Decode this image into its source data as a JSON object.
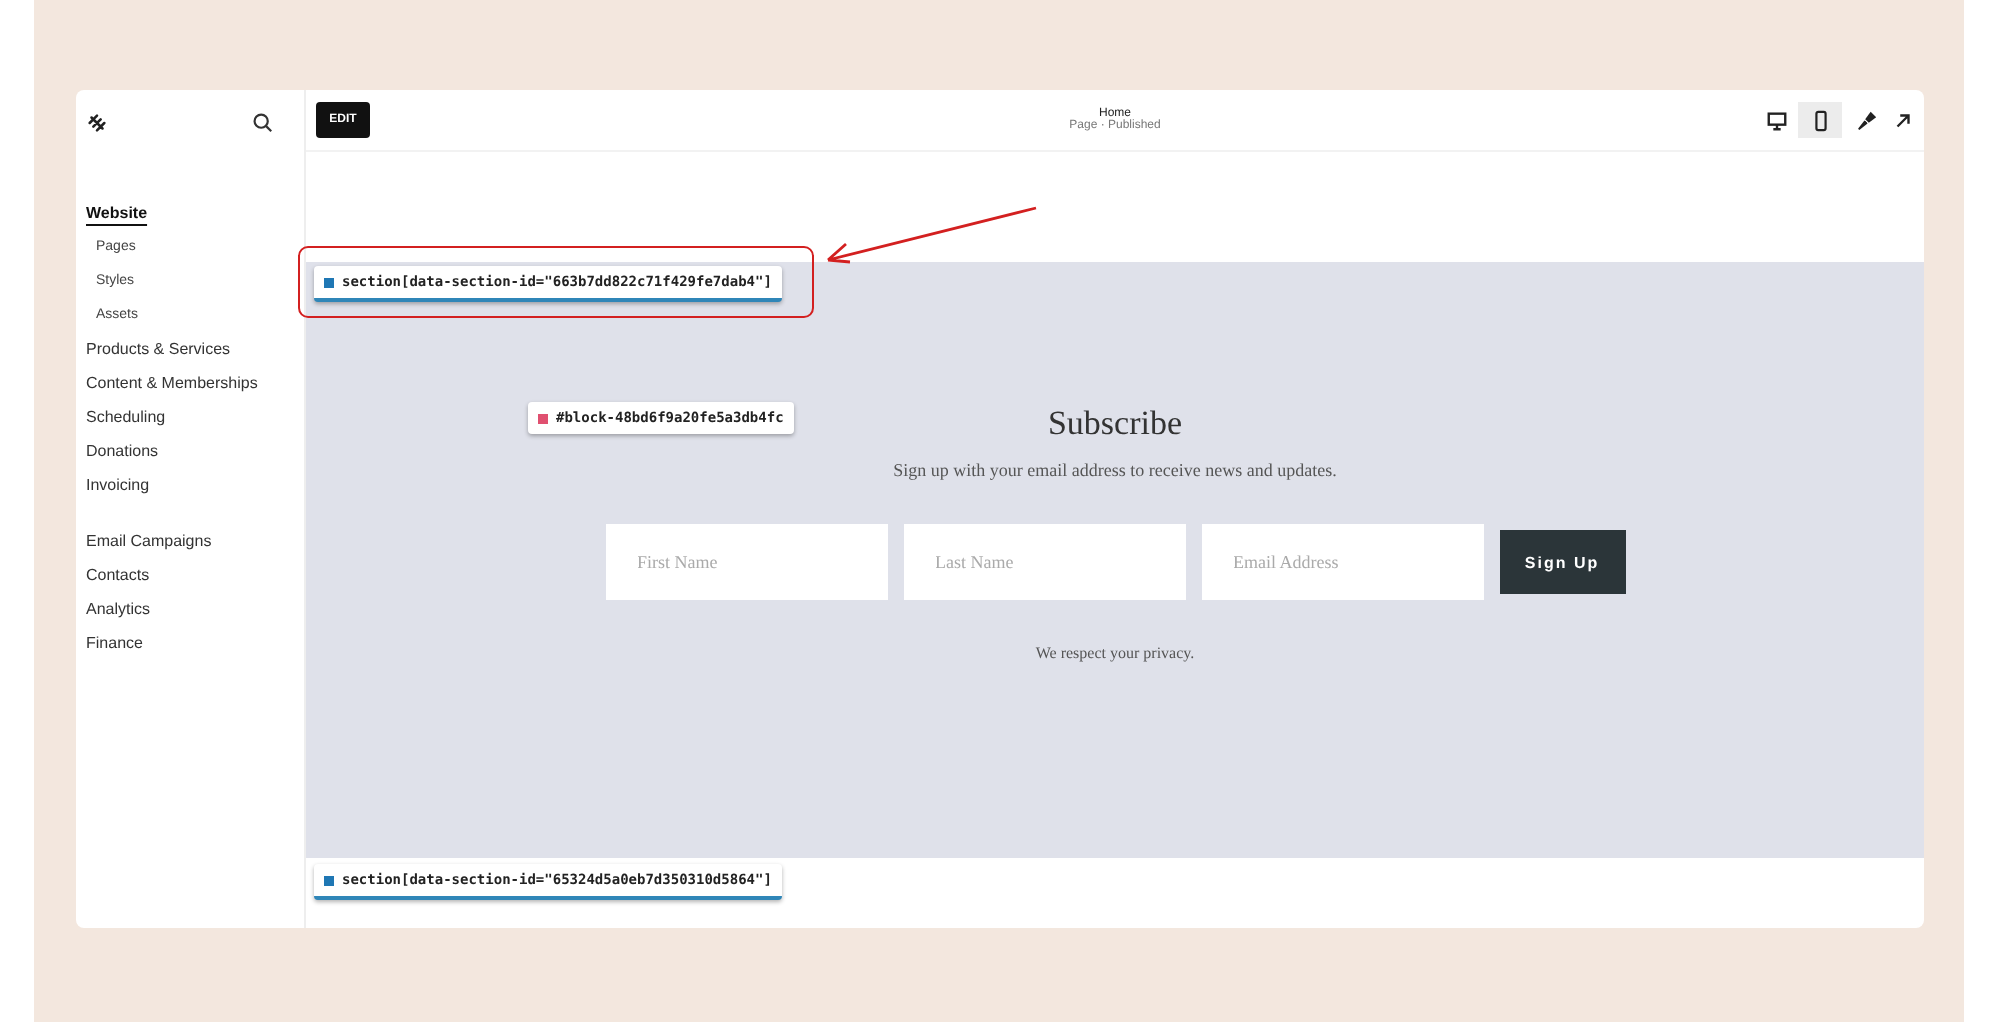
{
  "sidebar": {
    "items": [
      {
        "label": "Website",
        "selected": true,
        "children": [
          {
            "label": "Pages"
          },
          {
            "label": "Styles"
          },
          {
            "label": "Assets"
          }
        ]
      },
      {
        "label": "Products & Services",
        "selected": false
      },
      {
        "label": "Content & Memberships",
        "selected": false
      },
      {
        "label": "Scheduling",
        "selected": false
      },
      {
        "label": "Donations",
        "selected": false
      },
      {
        "label": "Invoicing",
        "selected": false
      }
    ],
    "items_2": [
      {
        "label": "Email Campaigns"
      },
      {
        "label": "Contacts"
      },
      {
        "label": "Analytics"
      },
      {
        "label": "Finance"
      }
    ]
  },
  "topbar": {
    "edit_button": "EDIT",
    "title": "Home",
    "subtitle": "Page · Published",
    "devices": [
      {
        "kind": "desktop",
        "selected": false
      },
      {
        "kind": "mobile",
        "selected": true
      }
    ]
  },
  "section": {
    "heading": "Subscribe",
    "description": "Sign up with your email address to receive news and updates.",
    "fields": [
      {
        "placeholder": "First Name"
      },
      {
        "placeholder": "Last Name"
      },
      {
        "placeholder": "Email Address"
      }
    ],
    "button": "Sign Up",
    "note": "We respect your privacy."
  },
  "labels": [
    {
      "kind": "section",
      "text": "section[data-section-id=\"663b7dd822c71f429fe7dab4\"]",
      "highlighted": true
    },
    {
      "kind": "block",
      "text": "#block-48bd6f9a20fe5a3db4fc",
      "highlighted": false
    },
    {
      "kind": "section",
      "text": "section[data-section-id=\"65324d5a0eb7d350310d5864\"]",
      "highlighted": false
    }
  ]
}
